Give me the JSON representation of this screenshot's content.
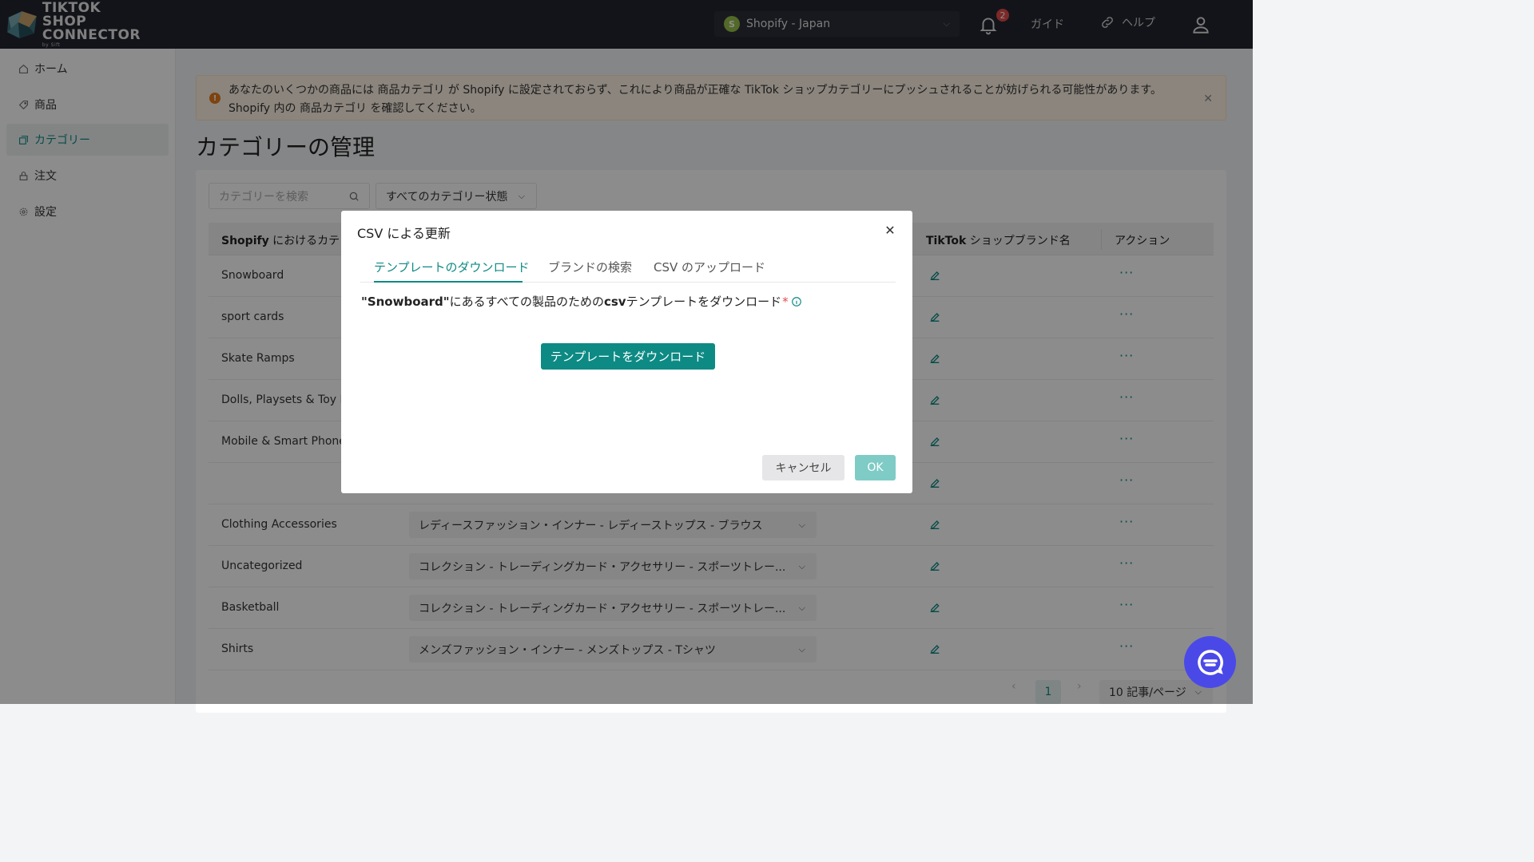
{
  "header": {
    "logo_line1": "TIKTOK SHOP",
    "logo_line2": "CONNECTOR",
    "logo_by": "by Sift",
    "store": "Shopify - Japan",
    "notifications": "2",
    "guide": "ガイド",
    "help": "ヘルプ"
  },
  "sidebar": {
    "items": [
      {
        "label": "ホーム",
        "icon": "home-icon"
      },
      {
        "label": "商品",
        "icon": "tag-icon"
      },
      {
        "label": "カテゴリー",
        "icon": "category-icon"
      },
      {
        "label": "注文",
        "icon": "lock-icon"
      },
      {
        "label": "設定",
        "icon": "gear-icon"
      }
    ],
    "active": "カテゴリー"
  },
  "alert": {
    "line1": "あなたのいくつかの商品には 商品カテゴリ が Shopify に設定されておらず、これにより商品が正確な TikTok ショップカテゴリーにプッシュされることが妨げられる可能性があります。",
    "line2": "Shopify 内の 商品カテゴリ を確認してください。"
  },
  "page": {
    "title": "カテゴリーの管理",
    "search_placeholder": "カテゴリーを検索",
    "status_filter": "すべてのカテゴリー状態"
  },
  "table": {
    "headers": {
      "shopify_category_bold": "Shopify",
      "shopify_category_rest": " におけるカテゴ",
      "brand_bold": "TikTok",
      "brand_rest": " ショップブランド名",
      "action": "アクション"
    },
    "rows": [
      {
        "name": "Snowboard",
        "category": ""
      },
      {
        "name": "sport cards",
        "category": ""
      },
      {
        "name": "Skate Ramps",
        "category": ""
      },
      {
        "name": "Dolls, Playsets & Toy Fig",
        "category": ""
      },
      {
        "name": "Mobile & Smart Phones",
        "category": ""
      },
      {
        "name": "",
        "category": ""
      },
      {
        "name": "Clothing Accessories",
        "category": "レディースファッション・インナー - レディーストップス - ブラウス"
      },
      {
        "name": "Uncategorized",
        "category": "コレクション - トレーディングカード・アクセサリー - スポーツトレー..."
      },
      {
        "name": "Basketball",
        "category": "コレクション - トレーディングカード・アクセサリー - スポーツトレー..."
      },
      {
        "name": "Shirts",
        "category": "メンズファッション・インナー - メンズトップス - Tシャツ"
      }
    ],
    "more": "···"
  },
  "pagination": {
    "current": "1",
    "prev": "‹",
    "next": "›",
    "page_size": "10 記事/ページ"
  },
  "modal": {
    "title": "CSV による更新",
    "tabs": [
      "テンプレートのダウンロード",
      "ブランドの検索",
      "CSV のアップロード"
    ],
    "active_tab": 0,
    "desc_quote_open": "\"",
    "desc_category": "Snowboard",
    "desc_quote_close": "\"",
    "desc_middle": " にあるすべての製品のための ",
    "desc_csv": "csv",
    "desc_end": " テンプレートをダウンロード",
    "desc_required": "*",
    "download_button": "テンプレートをダウンロード",
    "cancel_button": "キャンセル",
    "ok_button": "OK"
  },
  "colors": {
    "accent": "#0d8a84",
    "topbar": "#23262f",
    "badge": "#e24c4b",
    "chat": "#4a49e8"
  }
}
